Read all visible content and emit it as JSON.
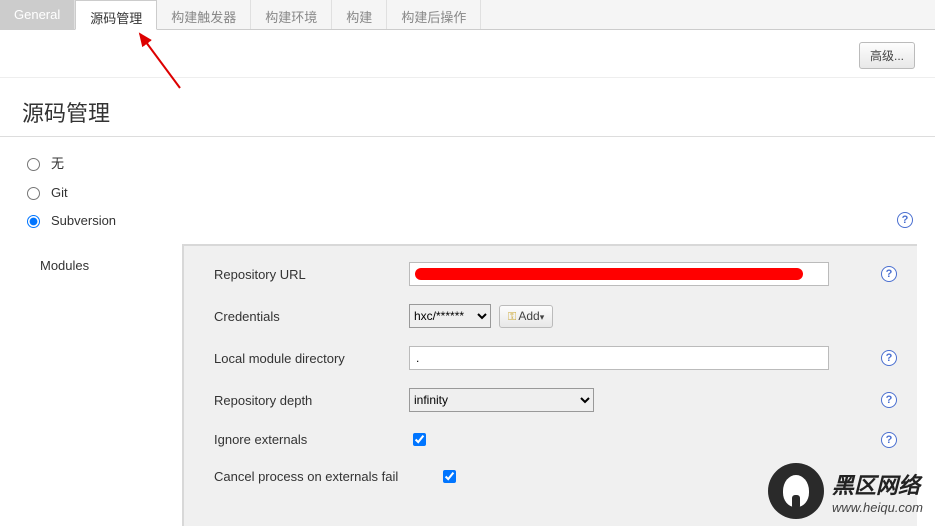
{
  "tabs": {
    "general": "General",
    "scm": "源码管理",
    "triggers": "构建触发器",
    "env": "构建环境",
    "build": "构建",
    "post": "构建后操作"
  },
  "advanced_btn": "高级...",
  "section_title": "源码管理",
  "scm_options": {
    "none": "无",
    "git": "Git",
    "svn": "Subversion"
  },
  "modules_label": "Modules",
  "fields": {
    "repo_url_label": "Repository URL",
    "repo_url_value": "",
    "creds_label": "Credentials",
    "creds_value": "hxc/******",
    "add_btn": "Add",
    "local_dir_label": "Local module directory",
    "local_dir_value": ".",
    "depth_label": "Repository depth",
    "depth_value": "infinity",
    "ignore_ext_label": "Ignore externals",
    "cancel_ext_label": "Cancel process on externals fail"
  },
  "watermark": {
    "cn": "黑区网络",
    "en": "www.heiqu.com"
  }
}
